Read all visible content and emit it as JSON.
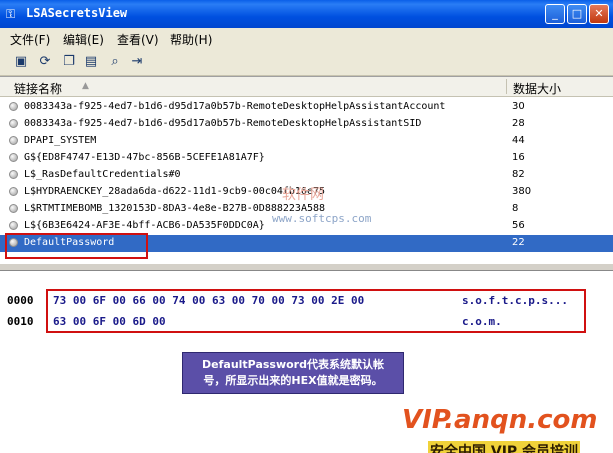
{
  "window": {
    "title": "LSASecretsView",
    "min": "_",
    "max": "□",
    "close": "✕"
  },
  "menu": {
    "file": "文件(F)",
    "edit": "编辑(E)",
    "view": "查看(V)",
    "help": "帮助(H)"
  },
  "toolbar": {
    "icons": [
      "save-icon",
      "refresh-icon",
      "copy-icon",
      "properties-icon",
      "find-icon",
      "exit-icon"
    ]
  },
  "list": {
    "headers": {
      "name": "链接名称",
      "size": "数据大小"
    },
    "rows": [
      {
        "name": "0083343a-f925-4ed7-b1d6-d95d17a0b57b-RemoteDesktopHelpAssistantAccount",
        "size": "30"
      },
      {
        "name": "0083343a-f925-4ed7-b1d6-d95d17a0b57b-RemoteDesktopHelpAssistantSID",
        "size": "28"
      },
      {
        "name": "DPAPI_SYSTEM",
        "size": "44"
      },
      {
        "name": "G${ED8F4747-E13D-47bc-856B-5CEFE1A81A7F}",
        "size": "16"
      },
      {
        "name": "L$_RasDefaultCredentials#0",
        "size": "82"
      },
      {
        "name": "L$HYDRAENCKEY_28ada6da-d622-11d1-9cb9-00c04fb16e75",
        "size": "380"
      },
      {
        "name": "L$RTMTIMEBOMB_1320153D-8DA3-4e8e-B27B-0D888223A588",
        "size": "8"
      },
      {
        "name": "L${6B3E6424-AF3E-4bff-ACB6-DA535F0DDC0A}",
        "size": "56"
      },
      {
        "name": "DefaultPassword",
        "size": "22"
      }
    ]
  },
  "hex": [
    {
      "offset": "0000",
      "bytes": "73 00 6F 00 66 00 74 00 63 00 70 00 73 00 2E 00",
      "ascii": "s.o.f.t.c.p.s..."
    },
    {
      "offset": "0010",
      "bytes": "63 00 6F 00 6D 00",
      "ascii": "c.o.m."
    }
  ],
  "note": {
    "line1": "DefaultPassword代表系统默认帐",
    "line2": "号，所显示出来的HEX值就是密码。"
  },
  "watermark": {
    "cn": "软件网",
    "url": "www.softcps.com"
  },
  "branding": {
    "vip": "VIP.anqn.com",
    "slogan": "安全中国 VIP 会员培训"
  }
}
